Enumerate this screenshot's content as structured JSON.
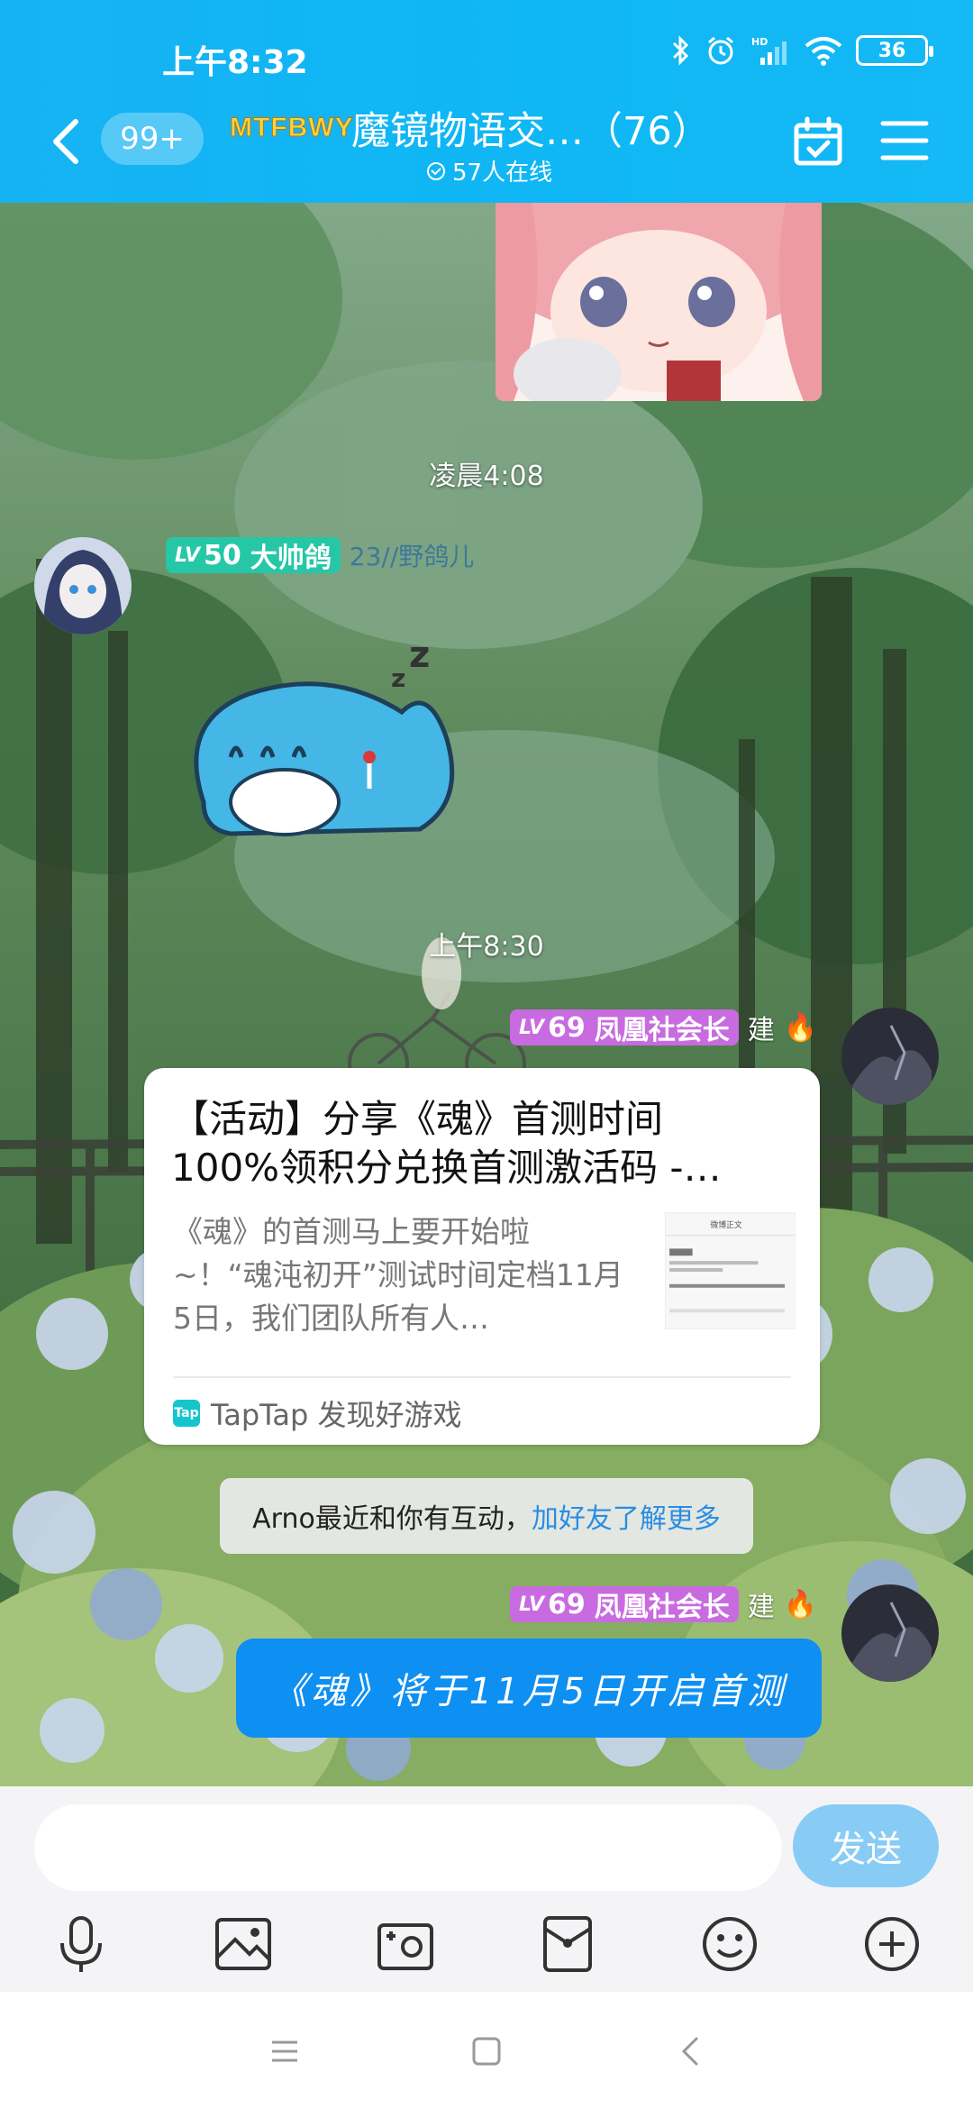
{
  "status_bar": {
    "time": "上午8:32",
    "battery": "36",
    "icons": [
      "bluetooth-icon",
      "alarm-icon",
      "signal-hd-icon",
      "wifi-icon",
      "battery-icon"
    ]
  },
  "header": {
    "unread_count": "99+",
    "group_logo": "MTFBWY",
    "group_title": "魔镜物语交…（76）",
    "online_text": "57人在线",
    "icons": [
      "back-icon",
      "calendar-check-icon",
      "menu-icon"
    ]
  },
  "chat": {
    "timestamps": [
      "凌晨4:08",
      "上午8:30"
    ],
    "messages": [
      {
        "sender": "大帅鸽",
        "level": "50",
        "level_prefix": "LV",
        "subtitle": "23//野鸽儿",
        "type": "sticker",
        "sticker": "sleeping-blue-cat-sticker"
      },
      {
        "sender": "凤凰社会长",
        "level": "69",
        "level_prefix": "LV",
        "role_tag": "建",
        "type": "link-card",
        "card": {
          "title": "【活动】分享《魂》首测时间100%领积分兑换首测激活码 -…",
          "description": "《魂》的首测马上要开始啦~！“魂沌初开”测试时间定档11月5日，我们团队所有人…",
          "thumbnail_caption": "微博正文",
          "source": "TapTap 发现好游戏",
          "source_logo": "Tap"
        }
      },
      {
        "sender": "凤凰社会长",
        "level": "69",
        "level_prefix": "LV",
        "role_tag": "建",
        "type": "text",
        "text": "《魂》将于11月5日开启首测"
      }
    ],
    "notice": {
      "text": "Arno最近和你有互动，",
      "link": "加好友了解更多"
    }
  },
  "input_bar": {
    "placeholder": "",
    "send_label": "发送",
    "tools": [
      "microphone-icon",
      "image-icon",
      "camera-icon",
      "red-packet-icon",
      "emoji-icon",
      "plus-icon"
    ]
  },
  "system_nav": [
    "recents-icon",
    "home-icon",
    "back-nav-icon"
  ],
  "colors": {
    "header_blue": "#16b3f3",
    "send_button": "#88ccf5",
    "message_blue": "#0e8ff2",
    "level_green": "#26c7a6",
    "level_purple": "#c86be0",
    "link_blue": "#2a8de4"
  }
}
